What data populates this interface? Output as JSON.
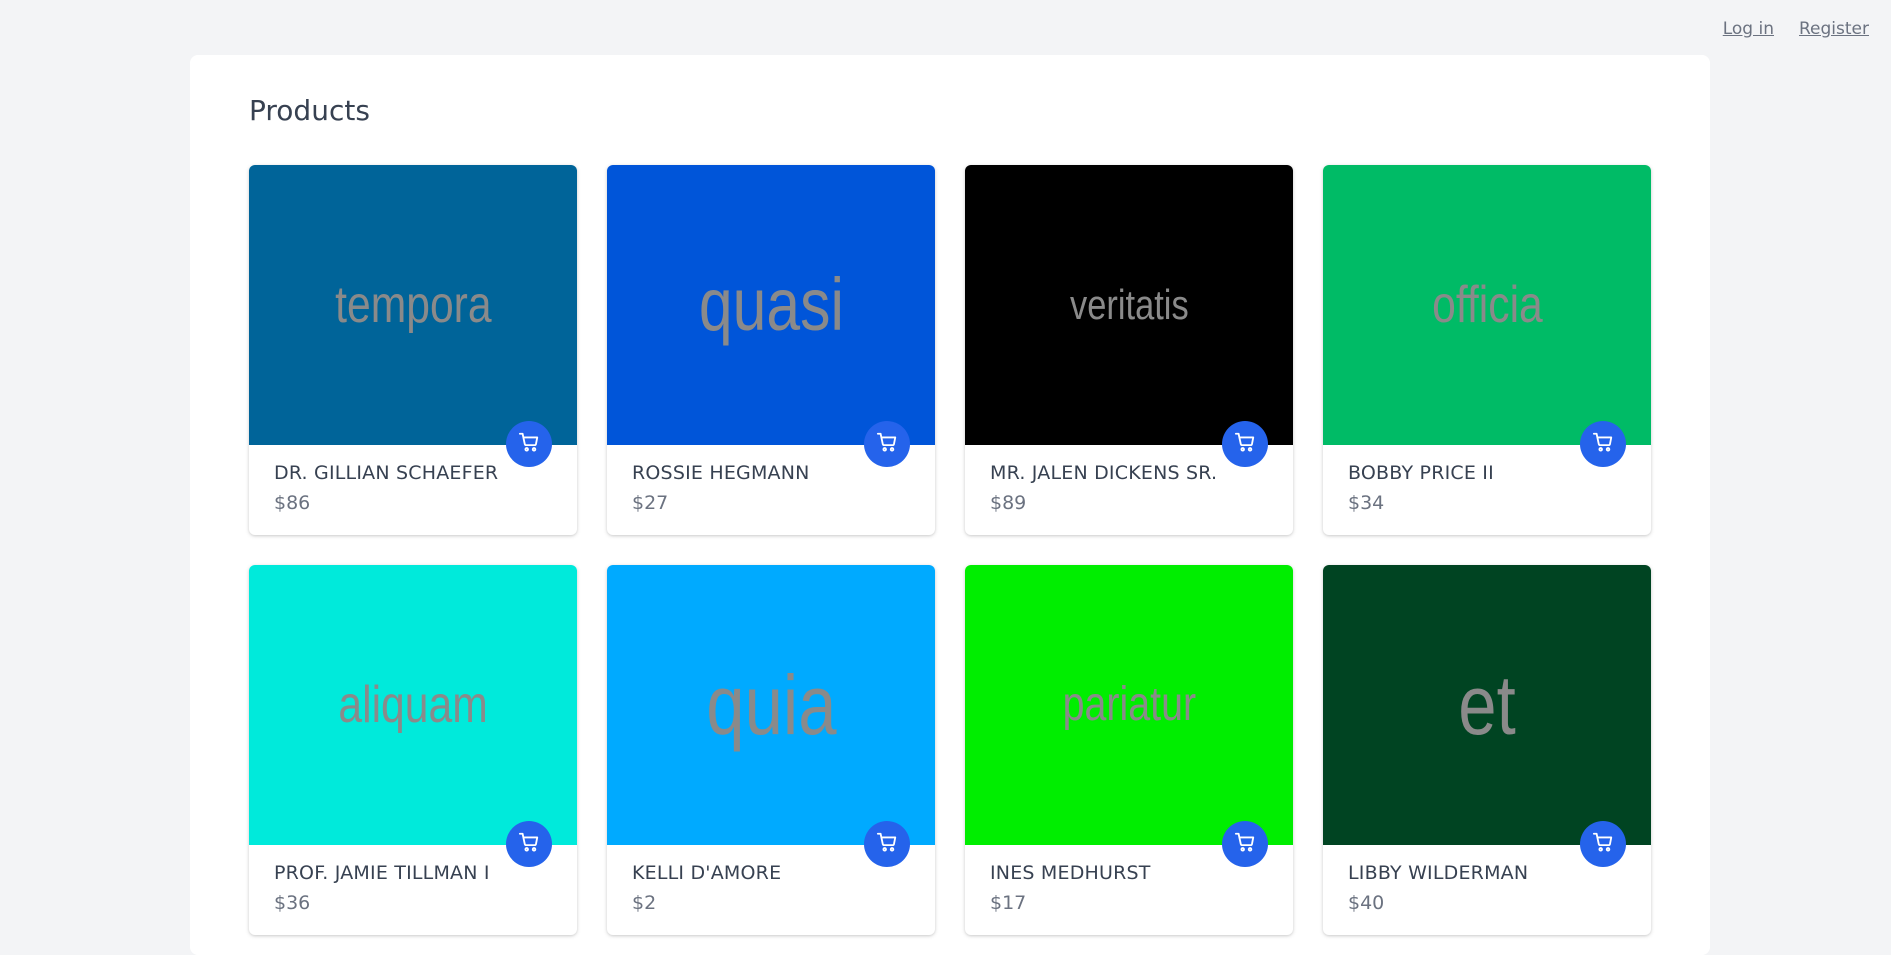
{
  "nav": {
    "login": "Log in",
    "register": "Register"
  },
  "page": {
    "title": "Products"
  },
  "products": [
    {
      "image_text": "tempora",
      "bg": "#006499",
      "name": "DR. GILLIAN SCHAEFER",
      "price": "$86",
      "text_size": 52
    },
    {
      "image_text": "quasi",
      "bg": "#0055d9",
      "name": "ROSSIE HEGMANN",
      "price": "$27",
      "text_size": 74
    },
    {
      "image_text": "veritatis",
      "bg": "#000000",
      "name": "MR. JALEN DICKENS SR.",
      "price": "$89",
      "text_size": 42
    },
    {
      "image_text": "officia",
      "bg": "#00bb66",
      "name": "BOBBY PRICE II",
      "price": "$34",
      "text_size": 52
    },
    {
      "image_text": "aliquam",
      "bg": "#00eadb",
      "name": "PROF. JAMIE TILLMAN I",
      "price": "$36",
      "text_size": 52
    },
    {
      "image_text": "quia",
      "bg": "#00aaff",
      "name": "KELLI D'AMORE",
      "price": "$2",
      "text_size": 84
    },
    {
      "image_text": "pariatur",
      "bg": "#00ee00",
      "name": "INES MEDHURST",
      "price": "$17",
      "text_size": 48
    },
    {
      "image_text": "et",
      "bg": "#004422",
      "name": "LIBBY WILDERMAN",
      "price": "$40",
      "text_size": 84
    }
  ],
  "icons": {
    "cart": "cart-icon"
  },
  "colors": {
    "accent": "#2563eb",
    "background": "#f3f4f6"
  }
}
